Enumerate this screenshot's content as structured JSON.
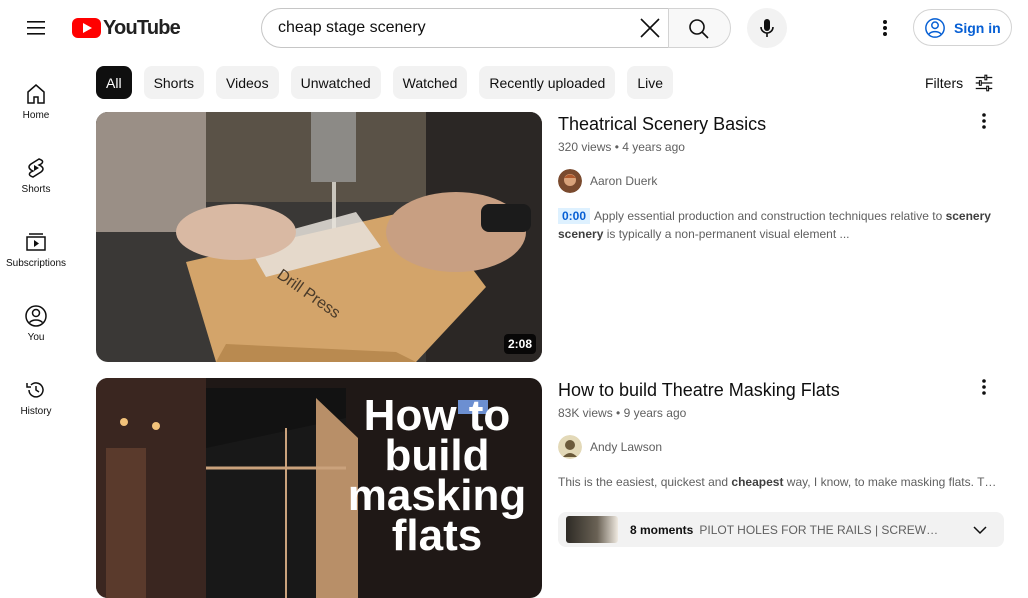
{
  "header": {
    "logo_text": "YouTube",
    "search_value": "cheap stage scenery",
    "signin_label": "Sign in"
  },
  "sidebar": {
    "items": [
      {
        "label": "Home",
        "icon": "home-icon"
      },
      {
        "label": "Shorts",
        "icon": "shorts-icon"
      },
      {
        "label": "Subscriptions",
        "icon": "subscriptions-icon"
      },
      {
        "label": "You",
        "icon": "you-icon"
      },
      {
        "label": "History",
        "icon": "history-icon"
      }
    ]
  },
  "chips": [
    "All",
    "Shorts",
    "Videos",
    "Unwatched",
    "Watched",
    "Recently uploaded",
    "Live"
  ],
  "filters_label": "Filters",
  "videos": [
    {
      "title": "Theatrical Scenery Basics",
      "views": "320 views",
      "age": "4 years ago",
      "channel": "Aaron Duerk",
      "duration": "2:08",
      "desc_ts": "0:00",
      "desc_a": "Apply essential production and construction techniques relative to ",
      "desc_b1": "scenery",
      "desc_b2": "scenery",
      "desc_c": " is typically a non-permanent visual element ..."
    },
    {
      "title": "How to build Theatre Masking Flats",
      "views": "83K views",
      "age": "9 years ago",
      "channel": "Andy Lawson",
      "desc_a": "This is the easiest, quickest and ",
      "desc_b": "cheapest",
      "desc_c": " way, I know, to make masking flats. The…",
      "thumb_text": "How to build masking flats",
      "moments_count": "8 moments",
      "moments_text": "PILOT HOLES FOR THE RAILS | SCREW…"
    }
  ],
  "colors": {
    "accent": "#065fd4",
    "brand": "#ff0000",
    "chip_bg": "#f2f2f2"
  }
}
